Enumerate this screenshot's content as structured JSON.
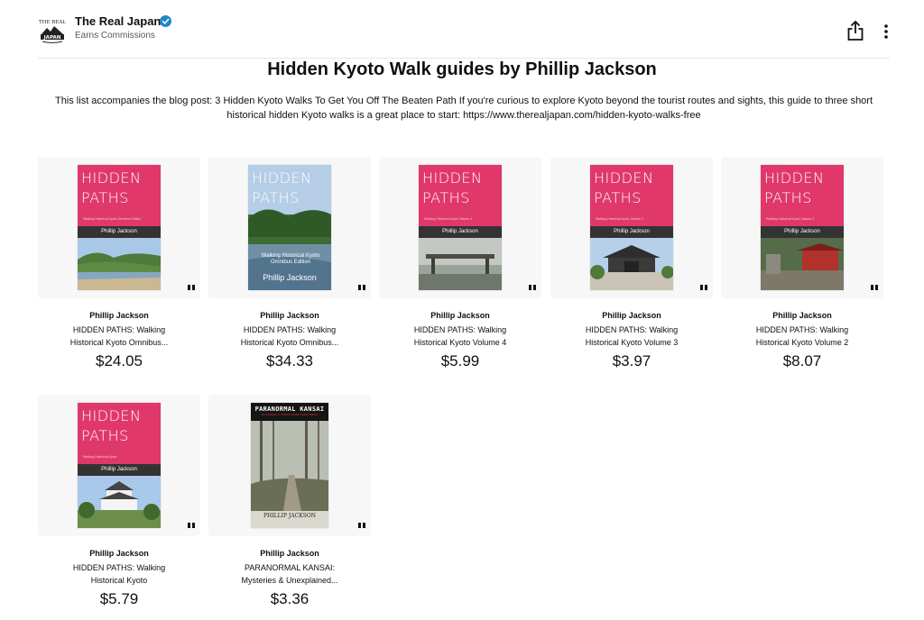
{
  "store": {
    "name": "The Real Japan",
    "subtitle": "Earns Commissions",
    "logo": {
      "line1": "THE REAL",
      "line2": "JAPAN"
    }
  },
  "page": {
    "title": "Hidden Kyoto Walk guides by Phillip Jackson",
    "description": "This list accompanies the blog post: 3 Hidden Kyoto Walks To Get You Off The Beaten Path If you're curious to explore Kyoto beyond the tourist routes and sights, this guide to three short historical hidden Kyoto walks is a great place to start: https://www.therealjapan.com/hidden-kyoto-walks-free"
  },
  "icons": {
    "share": "share-icon",
    "more": "more-vertical-icon",
    "quote": "quote-icon",
    "verified": "verified-check-icon"
  },
  "colors": {
    "cover_pink": "#e0386b",
    "verified": "#1f88c9",
    "price": "#0f1111"
  },
  "products": [
    {
      "author": "Phillip Jackson",
      "title_line1": "HIDDEN PATHS: Walking",
      "title_line2": "Historical Kyoto Omnibus...",
      "price": "$24.05",
      "cover": {
        "title1": "HIDDEN",
        "title2": "PATHS",
        "subtitle": "Walking Historical Kyoto Omnibus Edition",
        "author": "Phillip Jackson"
      }
    },
    {
      "author": "Phillip Jackson",
      "title_line1": "HIDDEN PATHS: Walking",
      "title_line2": "Historical Kyoto Omnibus...",
      "price": "$34.33",
      "cover": {
        "title1": "HIDDEN",
        "title2": "PATHS",
        "subtitle": "Walking Historical Kyoto Omnibus Edition",
        "author": "Phillip Jackson"
      }
    },
    {
      "author": "Phillip Jackson",
      "title_line1": "HIDDEN PATHS: Walking",
      "title_line2": "Historical Kyoto Volume 4",
      "price": "$5.99",
      "cover": {
        "title1": "HIDDEN",
        "title2": "PATHS",
        "subtitle": "Walking Historical Kyoto Volume 4",
        "author": "Phillip Jackson"
      }
    },
    {
      "author": "Phillip Jackson",
      "title_line1": "HIDDEN PATHS: Walking",
      "title_line2": "Historical Kyoto Volume 3",
      "price": "$3.97",
      "cover": {
        "title1": "HIDDEN",
        "title2": "PATHS",
        "subtitle": "Walking Historical Kyoto Volume 3",
        "author": "Phillip Jackson"
      }
    },
    {
      "author": "Phillip Jackson",
      "title_line1": "HIDDEN PATHS: Walking",
      "title_line2": "Historical Kyoto Volume 2",
      "price": "$8.07",
      "cover": {
        "title1": "HIDDEN",
        "title2": "PATHS",
        "subtitle": "Walking Historical Kyoto Volume 2",
        "author": "Phillip Jackson"
      }
    },
    {
      "author": "Phillip Jackson",
      "title_line1": "HIDDEN PATHS: Walking",
      "title_line2": "Historical Kyoto",
      "price": "$5.79",
      "cover": {
        "title1": "HIDDEN",
        "title2": "PATHS",
        "subtitle": "Walking Historical Kyoto",
        "author": "Phillip Jackson"
      }
    },
    {
      "author": "Phillip Jackson",
      "title_line1": "PARANORMAL KANSAI:",
      "title_line2": "Mysteries & Unexplained...",
      "price": "$3.36",
      "cover": {
        "title1": "PARANORMAL KANSAI",
        "subtitle": "MYSTERIES & UNEXPLAINED PHENOMENA",
        "author": "PHILLIP JACKSON"
      }
    }
  ]
}
